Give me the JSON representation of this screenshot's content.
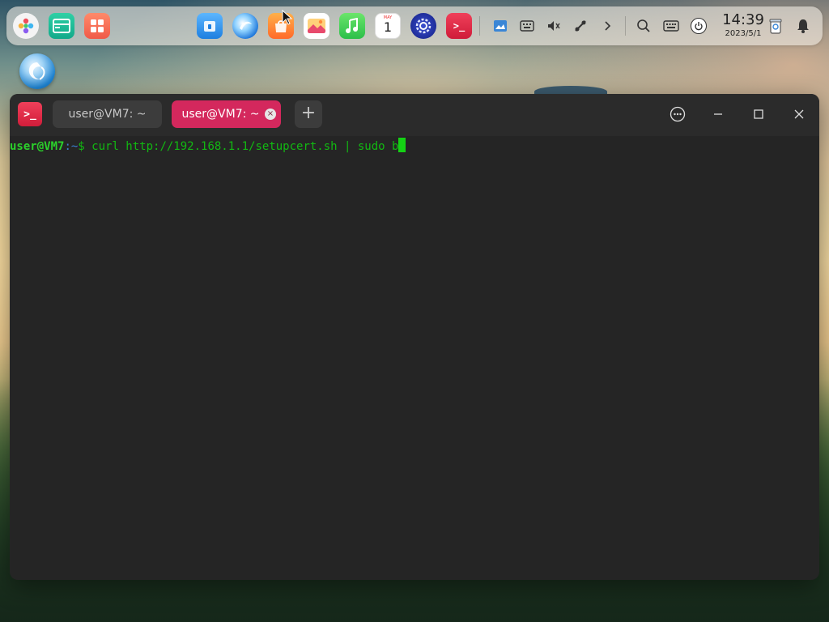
{
  "dock": {
    "apps": [
      {
        "name": "launcher",
        "icon": "launcher-icon"
      },
      {
        "name": "multitask-view",
        "icon": "multitask-icon"
      },
      {
        "name": "workspace",
        "icon": "workspace-icon"
      },
      {
        "name": "file-manager",
        "icon": "file-manager-icon"
      },
      {
        "name": "browser",
        "icon": "browser-icon"
      },
      {
        "name": "app-store",
        "icon": "app-store-icon"
      },
      {
        "name": "image-viewer",
        "icon": "image-viewer-icon"
      },
      {
        "name": "music",
        "icon": "music-icon"
      },
      {
        "name": "calendar",
        "icon": "calendar-icon",
        "day": "1",
        "month": "MAY"
      },
      {
        "name": "control-center",
        "icon": "settings-gear-icon"
      },
      {
        "name": "terminal",
        "icon": "terminal-icon"
      }
    ],
    "tray": [
      {
        "name": "screenshot",
        "icon": "screenshot-icon"
      },
      {
        "name": "keyboard",
        "icon": "onscreen-keyboard-icon"
      },
      {
        "name": "volume",
        "icon": "volume-muted-icon"
      },
      {
        "name": "network",
        "icon": "network-icon"
      },
      {
        "name": "expand",
        "icon": "chevron-right-icon"
      },
      {
        "name": "search",
        "icon": "search-icon"
      },
      {
        "name": "input-method",
        "icon": "keyboard-icon"
      },
      {
        "name": "power",
        "icon": "power-icon"
      }
    ],
    "clock": {
      "time": "14:39",
      "date": "2023/5/1"
    },
    "trash_icon": "trash-icon",
    "notification_icon": "bell-icon"
  },
  "desktop": {
    "icon": "deepin-logo-icon"
  },
  "window": {
    "app_icon_text": ">_",
    "tabs": [
      {
        "label": "user@VM7: ~",
        "active": false
      },
      {
        "label": "user@VM7: ~",
        "active": true,
        "close_glyph": "×"
      }
    ],
    "new_tab_label": "+",
    "controls": {
      "more": "more-options-icon",
      "minimize": "minimize-icon",
      "maximize": "maximize-icon",
      "close": "close-icon"
    }
  },
  "terminal": {
    "prompt_user": "user@VM7",
    "prompt_path": ":~",
    "prompt_symbol": "$",
    "command": " curl http://192.168.1.1/setupcert.sh | sudo b"
  },
  "colors": {
    "accent": "#d4285d",
    "terminal_bg": "#252525",
    "terminal_text": "#10c010"
  }
}
